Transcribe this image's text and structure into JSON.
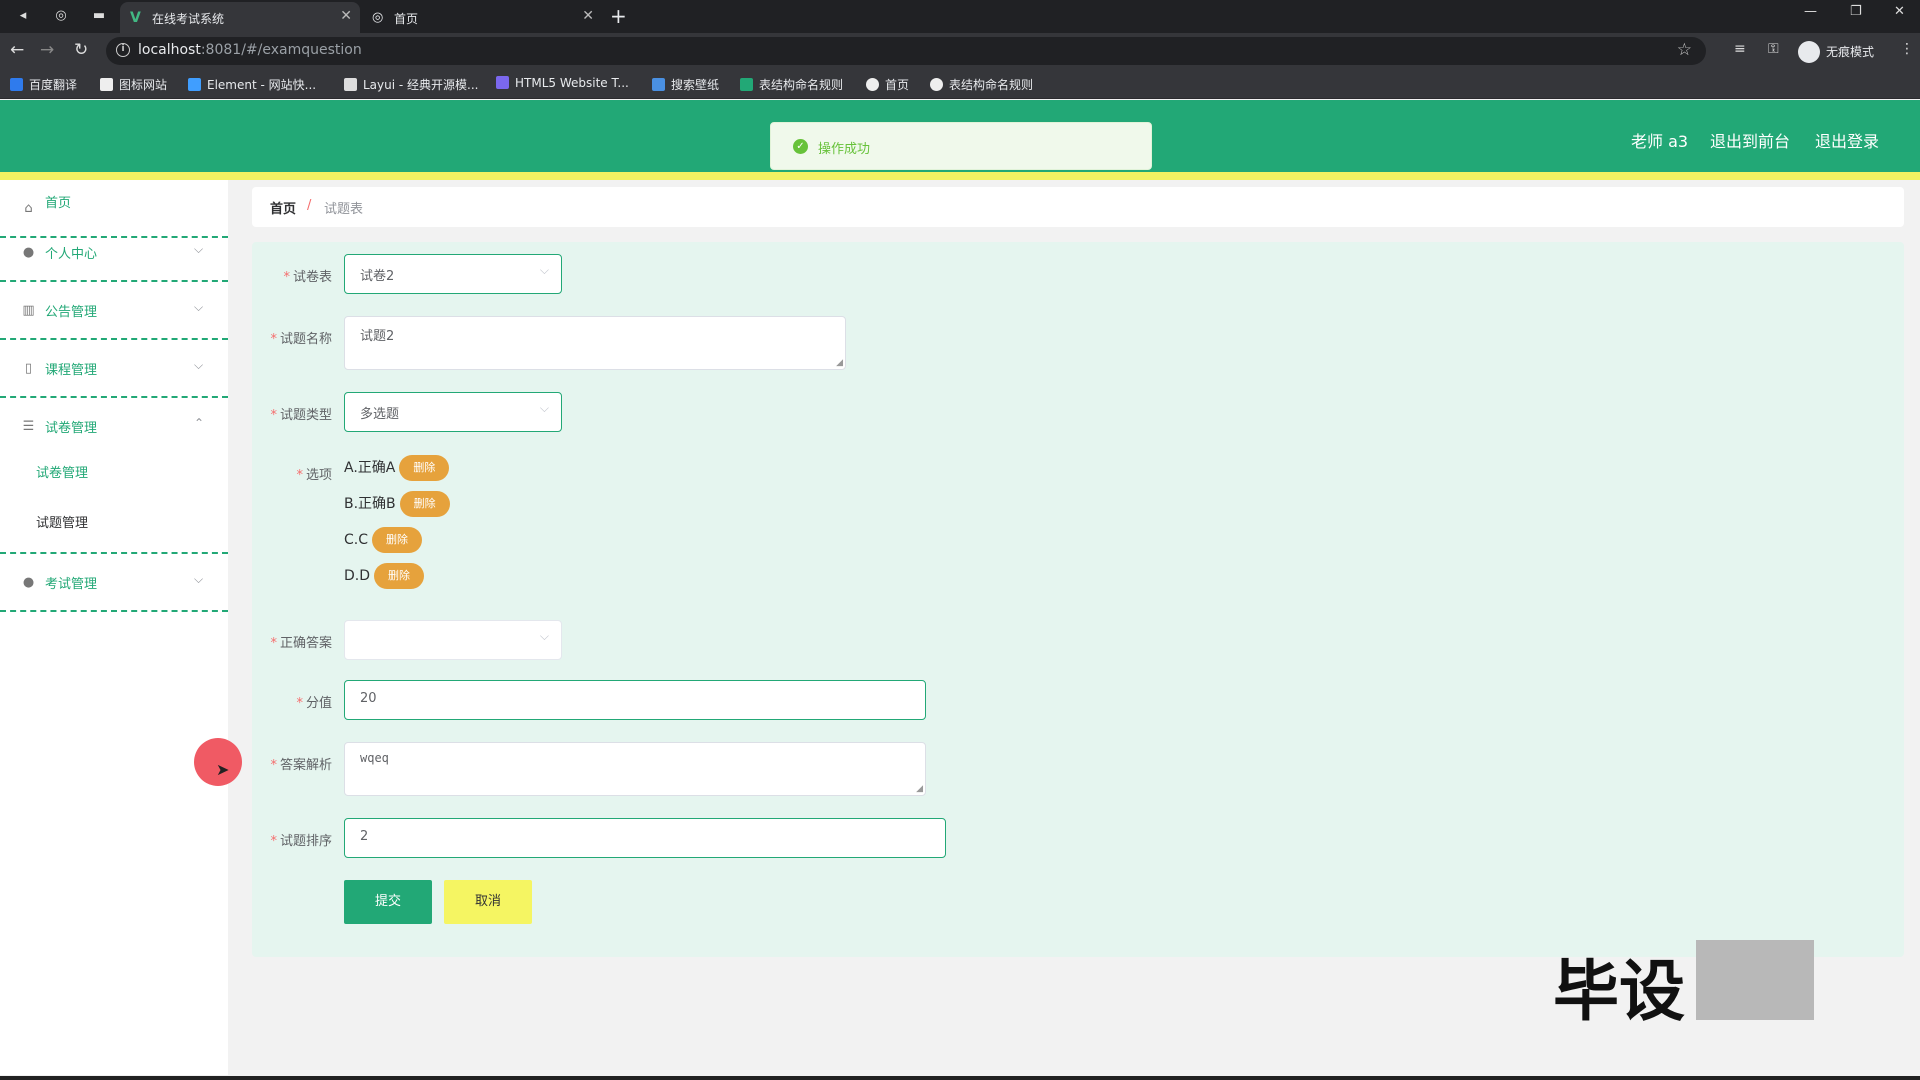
{
  "browser": {
    "tabs": [
      {
        "title": "在线考试系统",
        "active": true
      },
      {
        "title": "首页",
        "active": false
      }
    ],
    "url_host": "localhost",
    "url_rest": ":8081/#/examquestion",
    "incognito_label": "无痕模式",
    "bookmarks": [
      {
        "label": "百度翻译",
        "color": "#2f7bed"
      },
      {
        "label": "图标网站",
        "color": "#eeeeee"
      },
      {
        "label": "Element - 网站快...",
        "color": "#409eff"
      },
      {
        "label": "Layui - 经典开源模...",
        "color": "#eeeeee"
      },
      {
        "label": "HTML5 Website T...",
        "color": "#7b68ee"
      },
      {
        "label": "搜索壁纸",
        "color": "#4a90e2"
      },
      {
        "label": "表结构命名规则",
        "color": "#22a876"
      },
      {
        "label": "首页",
        "color": "#eeeeee"
      },
      {
        "label": "表结构命名规则",
        "color": "#eeeeee"
      }
    ]
  },
  "header": {
    "user": "老师 a3",
    "front_link": "退出到前台",
    "logout_link": "退出登录",
    "accent": "#22a876"
  },
  "toast": {
    "message": "操作成功"
  },
  "sidebar": {
    "home": "首页",
    "personal": "个人中心",
    "notice": "公告管理",
    "course": "课程管理",
    "exam_paper": "试卷管理",
    "sub_paper": "试卷管理",
    "sub_question": "试题管理",
    "exam": "考试管理"
  },
  "breadcrumb": {
    "home": "首页",
    "separator": "/",
    "current": "试题表"
  },
  "form": {
    "paper_label": "试卷表",
    "paper_value": "试卷2",
    "name_label": "试题名称",
    "name_value": "试题2",
    "type_label": "试题类型",
    "type_value": "多选题",
    "options_label": "选项",
    "options": [
      "A.正确A",
      "B.正确B",
      "C.C",
      "D.D"
    ],
    "delete_label": "删除",
    "answer_label": "正确答案",
    "answer_value": "",
    "score_label": "分值",
    "score_value": "20",
    "analysis_label": "答案解析",
    "analysis_value": "wqeq",
    "order_label": "试题排序",
    "order_value": "2",
    "submit": "提交",
    "cancel": "取消"
  },
  "watermark": "毕设"
}
